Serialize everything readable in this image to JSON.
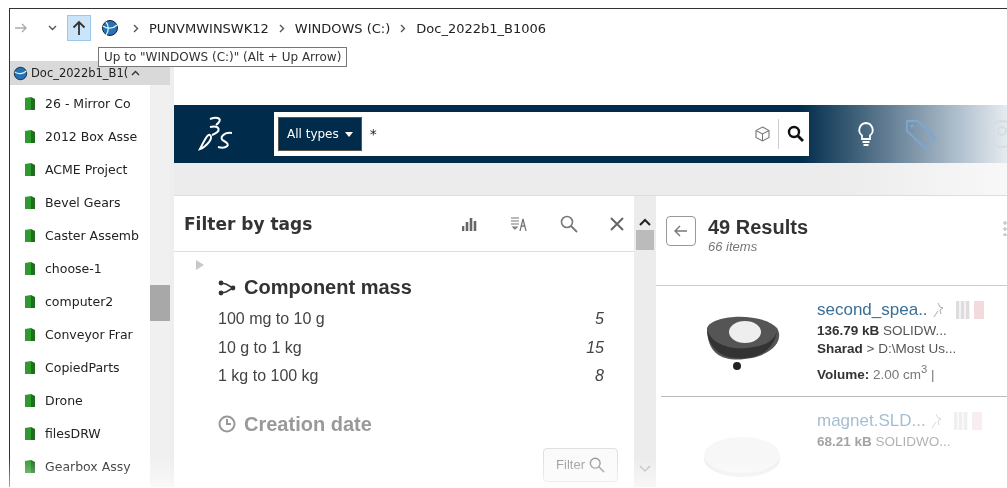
{
  "address_bar": {
    "breadcrumbs": [
      "PUNVMWINSWK12",
      "WINDOWS (C:)",
      "Doc_2022b1_B1006"
    ]
  },
  "tooltip": "Up to \"WINDOWS (C:)\" (Alt + Up Arrow)",
  "navigation_pane": {
    "root": "Doc_2022b1_B1(",
    "items": [
      {
        "label": "26 - Mirror Co"
      },
      {
        "label": "2012 Box Asse"
      },
      {
        "label": "ACME Project"
      },
      {
        "label": "Bevel Gears"
      },
      {
        "label": "Caster Assemb"
      },
      {
        "label": "choose-1"
      },
      {
        "label": "computer2"
      },
      {
        "label": "Conveyor Frar"
      },
      {
        "label": "CopiedParts"
      },
      {
        "label": "Drone"
      },
      {
        "label": "filesDRW"
      },
      {
        "label": "Gearbox Assy"
      }
    ]
  },
  "search": {
    "type_filter": "All types",
    "value": "*"
  },
  "filter_panel": {
    "title": "Filter by tags",
    "groups": [
      {
        "title": "Component mass",
        "kind": "mass",
        "expanded": true,
        "rows": [
          {
            "label": "100 mg to 10 g",
            "count": "5"
          },
          {
            "label": "10 g to 1 kg",
            "count": "15"
          },
          {
            "label": "1 kg to 100 kg",
            "count": "8"
          }
        ]
      },
      {
        "title": "Creation date",
        "kind": "date",
        "expanded": false
      }
    ],
    "filter_button": {
      "label": "Filter",
      "disabled": true
    }
  },
  "results": {
    "title": "49 Results",
    "subtitle": "66 items",
    "items": [
      {
        "name": "second_spea..",
        "size": "**136.79 kB** SOLIDW...",
        "path": "**Sharad** > D:\\Most Us...",
        "volume": "**Volume:** 2.00 cm$^{3}$ |"
      },
      {
        "name": "magnet.SLD...",
        "size": "**68.21 kB** SOLIDWO..."
      }
    ]
  }
}
